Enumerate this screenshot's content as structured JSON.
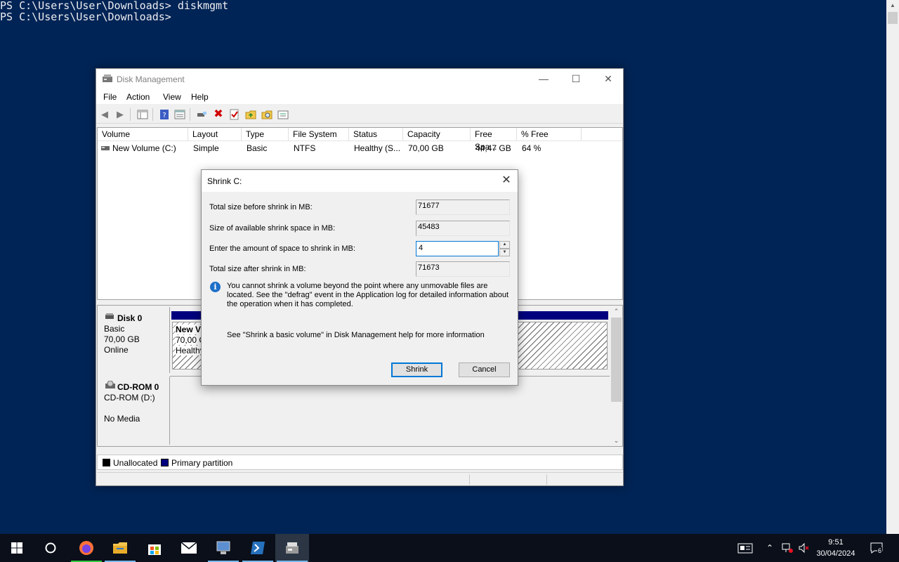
{
  "console": {
    "line1": "PS C:\\Users\\User\\Downloads> diskmgmt",
    "line2": "PS C:\\Users\\User\\Downloads>"
  },
  "window": {
    "title": "Disk Management",
    "menu": [
      "File",
      "Action",
      "View",
      "Help"
    ]
  },
  "volume_list": {
    "columns": [
      "Volume",
      "Layout",
      "Type",
      "File System",
      "Status",
      "Capacity",
      "Free Spa...",
      "% Free"
    ],
    "rows": [
      {
        "volume": "New Volume (C:)",
        "layout": "Simple",
        "type": "Basic",
        "file_system": "NTFS",
        "status": "Healthy (S...",
        "capacity": "70,00 GB",
        "free_space": "44,47 GB",
        "percent_free": "64 %"
      }
    ]
  },
  "disks": [
    {
      "name": "Disk 0",
      "type": "Basic",
      "size": "70,00 GB",
      "state": "Online",
      "partition": {
        "name": "New V",
        "size": "70,00 G",
        "status": "Healthy"
      }
    },
    {
      "name": "CD-ROM 0",
      "type": "CD-ROM (D:)",
      "state": "No Media"
    }
  ],
  "legend": {
    "unallocated": "Unallocated",
    "primary": "Primary partition",
    "unallocated_color": "#000000",
    "primary_color": "#00007f"
  },
  "dialog": {
    "title": "Shrink C:",
    "total_before_label": "Total size before shrink in MB:",
    "total_before_value": "71677",
    "available_label": "Size of available shrink space in MB:",
    "available_value": "45483",
    "amount_label": "Enter the amount of space to shrink in MB:",
    "amount_value": "4",
    "total_after_label": "Total size after shrink in MB:",
    "total_after_value": "71673",
    "info_text": "You cannot shrink a volume beyond the point where any unmovable files are located. See the \"defrag\" event in the Application log for detailed information about the operation when it has completed.",
    "help_text": "See \"Shrink a basic volume\" in Disk Management help for more information",
    "shrink_button": "Shrink",
    "cancel_button": "Cancel"
  },
  "taskbar": {
    "time": "9:51",
    "date": "30/04/2024",
    "notification_count": "6",
    "apps": [
      "start",
      "search",
      "firefox",
      "file-explorer",
      "store",
      "mail",
      "remote-desktop",
      "powershell",
      "disk-management"
    ]
  }
}
